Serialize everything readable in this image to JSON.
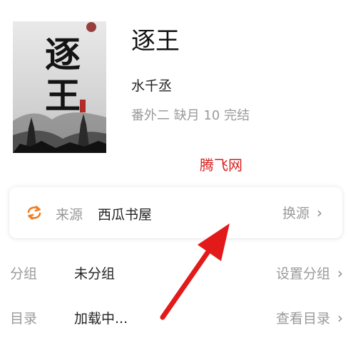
{
  "book": {
    "cover_title": "逐王",
    "title": "逐王",
    "author": "水千丞",
    "status": "番外二 缺月 10 完结"
  },
  "watermark": "腾飞网",
  "source": {
    "label": "来源",
    "value": "西瓜书屋",
    "action": "换源",
    "icon_color": "#f07d22"
  },
  "rows": [
    {
      "label": "分组",
      "value": "未分组",
      "action": "设置分组"
    },
    {
      "label": "目录",
      "value": "加载中...",
      "action": "查看目录"
    }
  ],
  "annotation": {
    "arrow_color": "#e21a1a"
  }
}
